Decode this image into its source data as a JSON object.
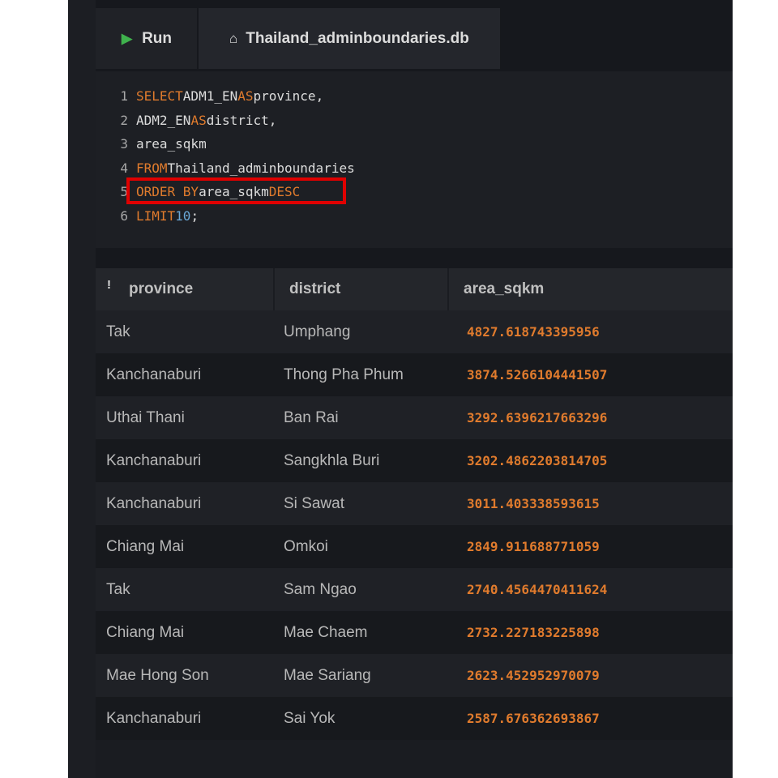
{
  "toolbar": {
    "run_label": "Run",
    "run_icon": "play-icon",
    "db_icon": "home-icon",
    "db_tab_label": "Thailand_adminboundaries.db"
  },
  "editor": {
    "line_numbers": [
      "1",
      "2",
      "3",
      "4",
      "5",
      "6"
    ],
    "tokens": {
      "select": "SELECT",
      "adm1": "ADM1_EN",
      "as1": "AS",
      "province_alias": "province,",
      "adm2": "ADM2_EN",
      "as2": "AS",
      "district_alias": "district,",
      "area": "area_sqkm",
      "from": "FROM",
      "table_name": "Thailand_adminboundaries",
      "order_by": "ORDER BY",
      "order_col": "area_sqkm",
      "desc": "DESC",
      "limit": "LIMIT",
      "limit_value": "10",
      "terminator": ";"
    }
  },
  "colors": {
    "keyword": "#e07b2d",
    "number_literal": "#6aa8d8",
    "run_icon": "#3fb24d",
    "highlight_border": "#e00000"
  },
  "table": {
    "sort_icon": "!",
    "headers": [
      "province",
      "district",
      "area_sqkm"
    ],
    "rows": [
      {
        "province": "Tak",
        "district": "Umphang",
        "area_sqkm": "4827.618743395956"
      },
      {
        "province": "Kanchanaburi",
        "district": "Thong Pha Phum",
        "area_sqkm": "3874.5266104441507"
      },
      {
        "province": "Uthai Thani",
        "district": "Ban Rai",
        "area_sqkm": "3292.6396217663296"
      },
      {
        "province": "Kanchanaburi",
        "district": "Sangkhla Buri",
        "area_sqkm": "3202.4862203814705"
      },
      {
        "province": "Kanchanaburi",
        "district": "Si Sawat",
        "area_sqkm": "3011.403338593615"
      },
      {
        "province": "Chiang Mai",
        "district": "Omkoi",
        "area_sqkm": "2849.911688771059"
      },
      {
        "province": "Tak",
        "district": "Sam Ngao",
        "area_sqkm": "2740.4564470411624"
      },
      {
        "province": "Chiang Mai",
        "district": "Mae Chaem",
        "area_sqkm": "2732.227183225898"
      },
      {
        "province": "Mae Hong Son",
        "district": "Mae Sariang",
        "area_sqkm": "2623.452952970079"
      },
      {
        "province": "Kanchanaburi",
        "district": "Sai Yok",
        "area_sqkm": "2587.676362693867"
      }
    ]
  }
}
